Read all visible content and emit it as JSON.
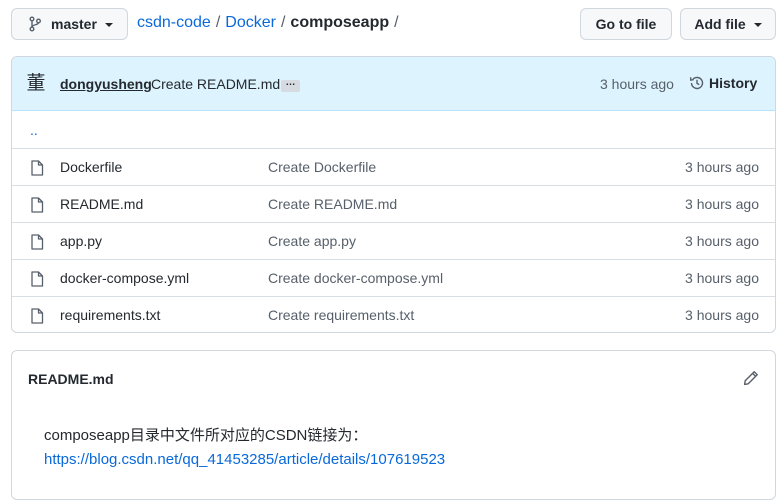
{
  "branch": {
    "label": "master"
  },
  "breadcrumb": {
    "repo": "csdn-code",
    "dir": "Docker",
    "current": "composeapp",
    "sep": "/"
  },
  "buttons": {
    "goto_file": "Go to file",
    "add_file": "Add file"
  },
  "commit": {
    "avatar": "董",
    "author": "dongyusheng",
    "message": "Create README.md",
    "ellipsis": "…",
    "time": "3 hours ago",
    "history_label": "History"
  },
  "parent_dir": "..",
  "files": [
    {
      "name": "Dockerfile",
      "message": "Create Dockerfile",
      "time": "3 hours ago"
    },
    {
      "name": "README.md",
      "message": "Create README.md",
      "time": "3 hours ago"
    },
    {
      "name": "app.py",
      "message": "Create app.py",
      "time": "3 hours ago"
    },
    {
      "name": "docker-compose.yml",
      "message": "Create docker-compose.yml",
      "time": "3 hours ago"
    },
    {
      "name": "requirements.txt",
      "message": "Create requirements.txt",
      "time": "3 hours ago"
    }
  ],
  "readme": {
    "title": "README.md",
    "text": "composeapp目录中文件所对应的CSDN链接为：",
    "link": "https://blog.csdn.net/qq_41453285/article/details/107619523"
  },
  "colors": {
    "accent": "#0969da",
    "commit_bg": "#ddf4ff",
    "border": "#d0d7de"
  },
  "icons": [
    "git-branch-icon",
    "history-icon",
    "file-icon",
    "pencil-icon"
  ]
}
